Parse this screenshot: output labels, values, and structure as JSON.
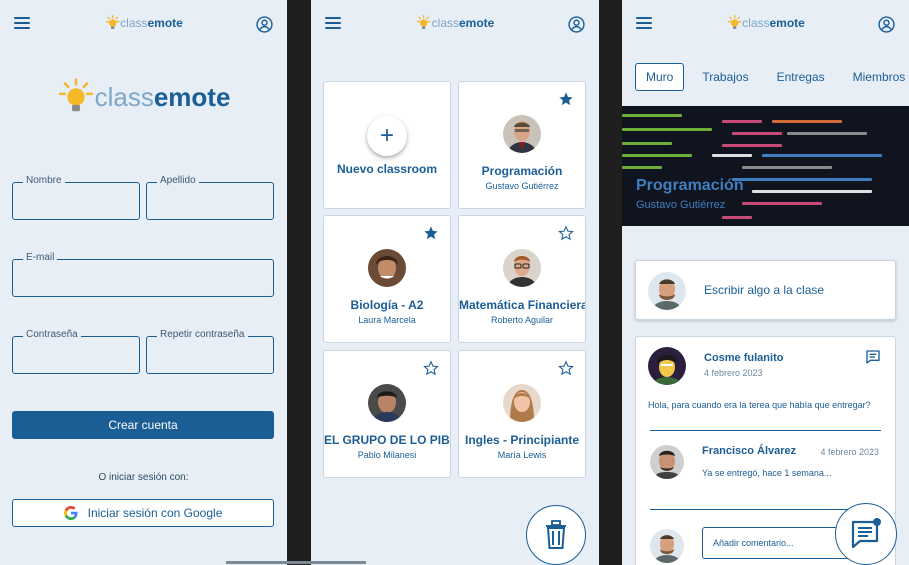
{
  "colors": {
    "primary": "#1b5e96",
    "background": "#e7eef6",
    "bulb": "#f4b829"
  },
  "logo": {
    "light": "class",
    "bold": "emote"
  },
  "signup": {
    "fields": {
      "nombre": "Nombre",
      "apellido": "Apellido",
      "email": "E-mail",
      "password": "Contraseña",
      "repeat_password": "Repetir contraseña"
    },
    "create_button": "Crear cuenta",
    "or_text": "O iniciar sesión con:",
    "google_button": "Iniciar sesión con Google"
  },
  "classrooms": {
    "new_label": "Nuevo classroom",
    "cards": [
      {
        "title": "Programación",
        "teacher": "Gustavo Gutiérrez",
        "starred": true
      },
      {
        "title": "Biología - A2",
        "teacher": "Laura Marcela",
        "starred": true
      },
      {
        "title": "Matemática Financiera",
        "teacher": "Roberto Aguilar",
        "starred": false
      },
      {
        "title": "EL GRUPO DE LO PIBE'",
        "teacher": "Pablo Milanesi",
        "starred": false
      },
      {
        "title": "Ingles - Principiante",
        "teacher": "María Lewis",
        "starred": false
      }
    ]
  },
  "course": {
    "tabs": [
      "Muro",
      "Trabajos",
      "Entregas",
      "Miembros"
    ],
    "active_tab": "Muro",
    "banner_title": "Programación",
    "banner_subtitle": "Gustavo Gutiérrez",
    "post_prompt": "Escribir algo a la clase",
    "post": {
      "author": "Cosme fulanito",
      "date": "4 febrero 2023",
      "text": "Hola, para cuando era la terea que había que entregar?",
      "comment": {
        "author": "Francisco Álvarez",
        "date": "4 febrero 2023",
        "text": "Ya se entregó, hace 1 semana..."
      },
      "comment_placeholder": "Añadir comentario..."
    }
  }
}
